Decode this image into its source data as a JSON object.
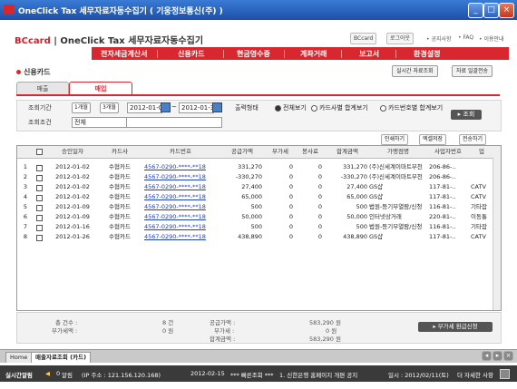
{
  "window": {
    "title": "OneClick Tax 세무자료자동수집기 ( 기웅정보통신(주) )"
  },
  "header": {
    "logo_brand": "BCcard",
    "logo_text": "| OneClick Tax 세무자료자동수집기",
    "btn_bccard": "BCcard",
    "btn_logout": "로그아웃",
    "link_notice": "• 공지사항",
    "link_faq": "• FAQ",
    "link_guide": "• 이용안내"
  },
  "menu": [
    "전자세금계산서",
    "신용카드",
    "현금영수증",
    "계좌거래",
    "보고서",
    "환경설정"
  ],
  "section": {
    "title": "신용카드",
    "btn_realtime": "실시간 자료조회",
    "btn_transfer": "자료 일괄전송"
  },
  "tabs": [
    {
      "label": "매출"
    },
    {
      "label": "매입"
    }
  ],
  "filter": {
    "period_label": "조회기간",
    "btn_1m": "1개월",
    "btn_3m": "3개월",
    "date_from": "2012-01-01",
    "tilde": "~",
    "date_to": "2012-01-31",
    "output_label": "출력형태",
    "radio_all": "전체보기",
    "radio_card_sum": "카드사별 합계보기",
    "radio_cardno_sum": "카드번호별 합계보기",
    "cond_label": "조회조건",
    "cond_value": "전체",
    "search_btn": "조회"
  },
  "toolbar": {
    "print": "인쇄하기",
    "excel": "엑셀저장",
    "send": "전송하기"
  },
  "table": {
    "headers": [
      "승인일자",
      "카드사",
      "카드번호",
      "공급가액",
      "부가세",
      "봉사료",
      "합계금액",
      "가맹점명",
      "사업자번호",
      "업"
    ],
    "rows": [
      {
        "no": "1",
        "date": "2012-01-02",
        "issuer": "수협카드",
        "card": "4567-0290-****-**18",
        "supply": "331,270",
        "vat": "0",
        "service": "0",
        "total": "331,270",
        "merchant": "(주)신세계이마트부천",
        "bizno": "206-86-..",
        "type": ""
      },
      {
        "no": "2",
        "date": "2012-01-02",
        "issuer": "수협카드",
        "card": "4567-0290-****-**18",
        "supply": "-330,270",
        "vat": "0",
        "service": "0",
        "total": "-330,270",
        "merchant": "(주)신세계이마트부천",
        "bizno": "206-86-..",
        "type": ""
      },
      {
        "no": "3",
        "date": "2012-01-02",
        "issuer": "수협카드",
        "card": "4567-0290-****-**18",
        "supply": "27,400",
        "vat": "0",
        "service": "0",
        "total": "27,400",
        "merchant": "GS샵",
        "bizno": "117-81-..",
        "type": "CATV"
      },
      {
        "no": "4",
        "date": "2012-01-02",
        "issuer": "수협카드",
        "card": "4567-0290-****-**18",
        "supply": "65,000",
        "vat": "0",
        "service": "0",
        "total": "65,000",
        "merchant": "GS샵",
        "bizno": "117-81-..",
        "type": "CATV"
      },
      {
        "no": "5",
        "date": "2012-01-09",
        "issuer": "수협카드",
        "card": "4567-0290-****-**18",
        "supply": "500",
        "vat": "0",
        "service": "0",
        "total": "500",
        "merchant": "법원-등기부열람/신청",
        "bizno": "116-81-..",
        "type": "기타잡"
      },
      {
        "no": "6",
        "date": "2012-01-09",
        "issuer": "수협카드",
        "card": "4567-0290-****-**18",
        "supply": "50,000",
        "vat": "0",
        "service": "0",
        "total": "50,000",
        "merchant": "인터넷상거래",
        "bizno": "220-81-..",
        "type": "이동통"
      },
      {
        "no": "7",
        "date": "2012-01-16",
        "issuer": "수협카드",
        "card": "4567-0290-****-**18",
        "supply": "500",
        "vat": "0",
        "service": "0",
        "total": "500",
        "merchant": "법원-등기부열람/신청",
        "bizno": "116-81-..",
        "type": "기타잡"
      },
      {
        "no": "8",
        "date": "2012-01-26",
        "issuer": "수협카드",
        "card": "4567-0290-****-**18",
        "supply": "438,890",
        "vat": "0",
        "service": "0",
        "total": "438,890",
        "merchant": "GS샵",
        "bizno": "117-81-..",
        "type": "CATV"
      }
    ]
  },
  "summary": {
    "count_label": "총 건수 :",
    "count_value": "8 건",
    "tax_label": "부가세액 :",
    "tax_value": "0 원",
    "supply_label": "공급가액 :",
    "supply_value": "583,290 원",
    "vat_label": "부가세 :",
    "vat_value": "0 원",
    "total_label": "합계금액 :",
    "total_value": "583,290 원",
    "refund_btn": "▸ 부가세 환급신청"
  },
  "bottom_tabs": [
    "Home",
    "매출자료조회 (카드)"
  ],
  "statusbar": {
    "alert_label": "실시간알림",
    "alert_count": "0",
    "notice_label": "알림",
    "ip": "(IP 주소 : 121.156.120.168)",
    "date": "2012-02-15",
    "quick": "*** 빠른조회 ***",
    "news": "1. 신한은행 홈페이지 개편 공지",
    "today": "일시 : 2012/02/11(토)",
    "more": "더 자세한 사항"
  }
}
